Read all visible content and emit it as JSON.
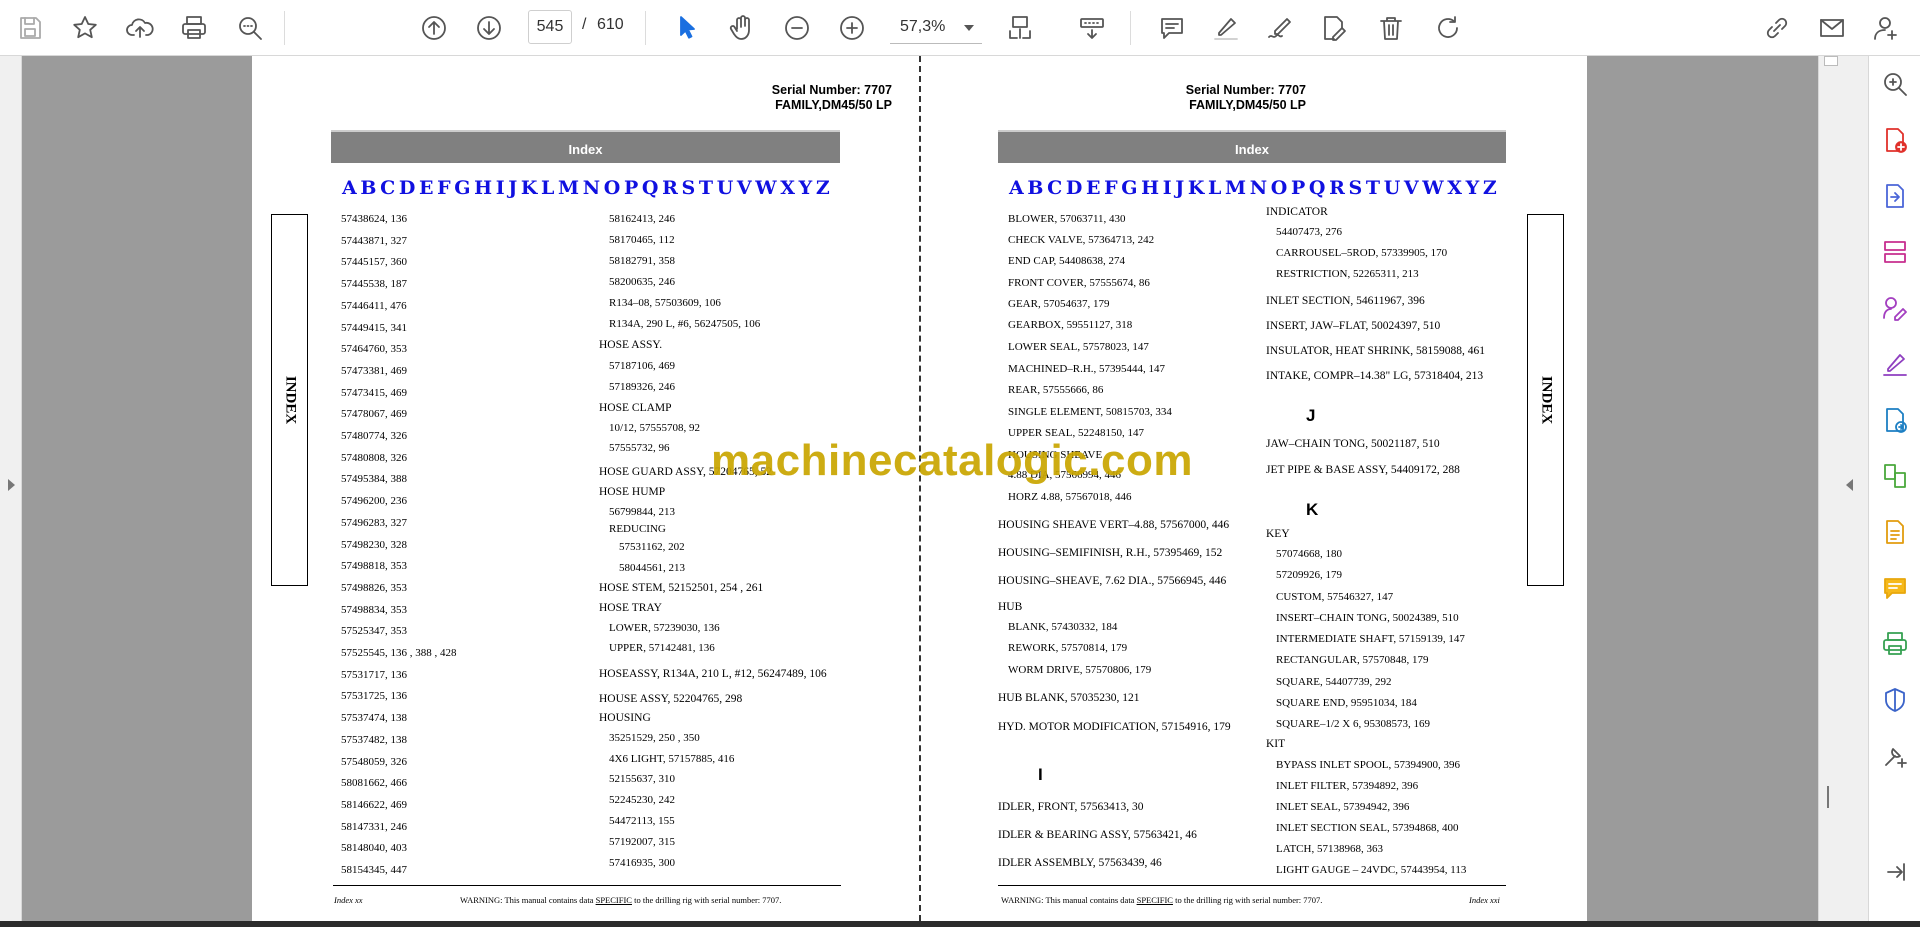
{
  "toolbar": {
    "page_current": "545",
    "page_separator": "/",
    "page_total": "610",
    "zoom": "57,3%"
  },
  "page_left": {
    "serial_line1": "Serial Number: 7707",
    "serial_line2": "FAMILY,DM45/50 LP",
    "index_title": "Index",
    "tab_label": "INDEX",
    "letters": [
      "A",
      "B",
      "C",
      "D",
      "E",
      "F",
      "G",
      "H",
      "I",
      "J",
      "K",
      "L",
      "M",
      "N",
      "O",
      "P",
      "Q",
      "R",
      "S",
      "T",
      "U",
      "V",
      "W",
      "X",
      "Y",
      "Z"
    ],
    "col1": [
      "57438624, 136",
      "57443871, 327",
      "57445157, 360",
      "57445538, 187",
      "57446411, 476",
      "57449415, 341",
      "57464760, 353",
      "57473381, 469",
      "57473415, 469",
      "57478067, 469",
      "57480774, 326",
      "57480808, 326",
      "57495384, 388",
      "57496200, 236",
      "57496283, 327",
      "57498230, 328",
      "57498818, 353",
      "57498826, 353",
      "57498834, 353",
      "57525347, 353",
      "57525545, 136 , 388 , 428",
      "57531717, 136",
      "57531725, 136",
      "57537474, 138",
      "57537482, 138",
      "57548059, 326",
      "58081662, 466",
      "58146622, 469",
      "58147331, 246",
      "58148040, 403",
      "58154345, 447"
    ],
    "col2": [
      {
        "t": "58162413, 246",
        "i": 1
      },
      {
        "t": "58170465, 112",
        "i": 1
      },
      {
        "t": "58182791, 358",
        "i": 1
      },
      {
        "t": "58200635, 246",
        "i": 1
      },
      {
        "t": "R134–08, 57503609, 106",
        "i": 1
      },
      {
        "t": "R134A, 290 L, #6, 56247505, 106",
        "i": 1
      },
      {
        "t": "HOSE ASSY.",
        "i": 0
      },
      {
        "t": "57187106, 469",
        "i": 1
      },
      {
        "t": "57189326, 246",
        "i": 1
      },
      {
        "t": "HOSE CLAMP",
        "i": 0
      },
      {
        "t": "10/12, 57555708, 92",
        "i": 1
      },
      {
        "t": "57555732, 96",
        "i": 1
      },
      {
        "t": "HOSE GUARD ASSY, 57204765, 52",
        "i": 0
      },
      {
        "t": "HOSE HUMP",
        "i": 0
      },
      {
        "t": "56799844, 213",
        "i": 1
      },
      {
        "t": "REDUCING",
        "i": 1
      },
      {
        "t": "57531162, 202",
        "i": 2
      },
      {
        "t": "58044561, 213",
        "i": 2
      },
      {
        "t": "HOSE STEM, 52152501, 254 , 261",
        "i": 0
      },
      {
        "t": "HOSE TRAY",
        "i": 0
      },
      {
        "t": "LOWER, 57239030, 136",
        "i": 1
      },
      {
        "t": "UPPER, 57142481, 136",
        "i": 1
      },
      {
        "t": "HOSEASSY, R134A, 210 L, #12, 56247489, 106",
        "i": 0
      },
      {
        "t": "HOUSE ASSY, 52204765, 298",
        "i": 0
      },
      {
        "t": "HOUSING",
        "i": 0
      },
      {
        "t": "35251529, 250 , 350",
        "i": 1
      },
      {
        "t": "4X6 LIGHT, 57157885, 416",
        "i": 1
      },
      {
        "t": "52155637, 310",
        "i": 1
      },
      {
        "t": "52245230, 242",
        "i": 1
      },
      {
        "t": "54472113, 155",
        "i": 1
      },
      {
        "t": "57192007, 315",
        "i": 1
      },
      {
        "t": "57416935, 300",
        "i": 1
      }
    ],
    "footer_left": "Index xx",
    "footer_warning_pre": "WARNING:  This manual contains data ",
    "footer_warning_u": "SPECIFIC",
    "footer_warning_post": " to the drilling rig with serial number: 7707."
  },
  "page_right": {
    "serial_line1": "Serial Number: 7707",
    "serial_line2": "FAMILY,DM45/50 LP",
    "index_title": "Index",
    "tab_label": "INDEX",
    "letters": [
      "A",
      "B",
      "C",
      "D",
      "E",
      "F",
      "G",
      "H",
      "I",
      "J",
      "K",
      "L",
      "M",
      "N",
      "O",
      "P",
      "Q",
      "R",
      "S",
      "T",
      "U",
      "V",
      "W",
      "X",
      "Y",
      "Z"
    ],
    "col1": [
      {
        "t": "BLOWER, 57063711, 430",
        "i": 1
      },
      {
        "t": "CHECK VALVE, 57364713, 242",
        "i": 1
      },
      {
        "t": "END CAP, 54408638, 274",
        "i": 1
      },
      {
        "t": "FRONT COVER, 57555674, 86",
        "i": 1
      },
      {
        "t": "GEAR, 57054637, 179",
        "i": 1
      },
      {
        "t": "GEARBOX, 59551127, 318",
        "i": 1
      },
      {
        "t": "LOWER SEAL, 57578023, 147",
        "i": 1
      },
      {
        "t": "MACHINED–R.H., 57395444, 147",
        "i": 1
      },
      {
        "t": "REAR, 57555666, 86",
        "i": 1
      },
      {
        "t": "SINGLE ELEMENT, 50815703, 334",
        "i": 1
      },
      {
        "t": "UPPER SEAL, 52248150, 147",
        "i": 1
      },
      {
        "t": "HOUSING SHEAVE",
        "i": 1
      },
      {
        "t": "4.88 DIA, 57566994, 446",
        "i": 1
      },
      {
        "t": "HORZ 4.88, 57567018, 446",
        "i": 1
      },
      {
        "t": "HOUSING SHEAVE VERT–4.88, 57567000, 446",
        "i": 0
      },
      {
        "t": "HOUSING–SEMIFINISH, R.H., 57395469, 152",
        "i": 0
      },
      {
        "t": "HOUSING–SHEAVE, 7.62 DIA., 57566945, 446",
        "i": 0
      },
      {
        "t": "HUB",
        "i": 0
      },
      {
        "t": "BLANK, 57430332, 184",
        "i": 1
      },
      {
        "t": "REWORK, 57570814, 179",
        "i": 1
      },
      {
        "t": "WORM DRIVE, 57570806, 179",
        "i": 1
      },
      {
        "t": "HUB BLANK, 57035230, 121",
        "i": 0
      },
      {
        "t": "HYD. MOTOR MODIFICATION, 57154916, 179",
        "i": 0
      },
      {
        "t": "I",
        "i": 9
      },
      {
        "t": "IDLER, FRONT, 57563413, 30",
        "i": 0
      },
      {
        "t": "IDLER & BEARING ASSY, 57563421, 46",
        "i": 0
      },
      {
        "t": "IDLER ASSEMBLY, 57563439, 46",
        "i": 0
      }
    ],
    "col2": [
      {
        "t": "INDICATOR",
        "i": 0
      },
      {
        "t": "54407473, 276",
        "i": 1
      },
      {
        "t": "CARROUSEL–5ROD, 57339905, 170",
        "i": 1
      },
      {
        "t": "RESTRICTION, 52265311, 213",
        "i": 1
      },
      {
        "t": "INLET SECTION, 54611967, 396",
        "i": 0
      },
      {
        "t": "INSERT, JAW–FLAT, 50024397, 510",
        "i": 0
      },
      {
        "t": "INSULATOR, HEAT SHRINK, 58159088, 461",
        "i": 0
      },
      {
        "t": "INTAKE, COMPR–14.38\" LG, 57318404, 213",
        "i": 0
      },
      {
        "t": "J",
        "i": 9
      },
      {
        "t": "JAW–CHAIN TONG, 50021187, 510",
        "i": 0
      },
      {
        "t": "JET PIPE & BASE ASSY, 54409172, 288",
        "i": 0
      },
      {
        "t": "K",
        "i": 9
      },
      {
        "t": "KEY",
        "i": 0
      },
      {
        "t": "57074668, 180",
        "i": 1
      },
      {
        "t": "57209926, 179",
        "i": 1
      },
      {
        "t": "CUSTOM, 57546327, 147",
        "i": 1
      },
      {
        "t": "INSERT–CHAIN TONG, 50024389, 510",
        "i": 1
      },
      {
        "t": "INTERMEDIATE SHAFT, 57159139, 147",
        "i": 1
      },
      {
        "t": "RECTANGULAR, 57570848, 179",
        "i": 1
      },
      {
        "t": "SQUARE, 54407739, 292",
        "i": 1
      },
      {
        "t": "SQUARE END, 95951034, 184",
        "i": 1
      },
      {
        "t": "SQUARE–1/2 X 6, 95308573, 169",
        "i": 1
      },
      {
        "t": "KIT",
        "i": 0
      },
      {
        "t": "BYPASS INLET SPOOL, 57394900, 396",
        "i": 1
      },
      {
        "t": "INLET FILTER, 57394892, 396",
        "i": 1
      },
      {
        "t": "INLET SEAL, 57394942, 396",
        "i": 1
      },
      {
        "t": "INLET SECTION SEAL, 57394868, 400",
        "i": 1
      },
      {
        "t": "LATCH, 57138968, 363",
        "i": 1
      },
      {
        "t": "LIGHT GAUGE – 24VDC, 57443954, 113",
        "i": 1
      }
    ],
    "footer_right": "Index xxi",
    "footer_warning_pre": "WARNING:  This manual contains data ",
    "footer_warning_u": "SPECIFIC",
    "footer_warning_post": " to the drilling rig with serial number: 7707."
  },
  "watermark": "machinecatalogic.com"
}
